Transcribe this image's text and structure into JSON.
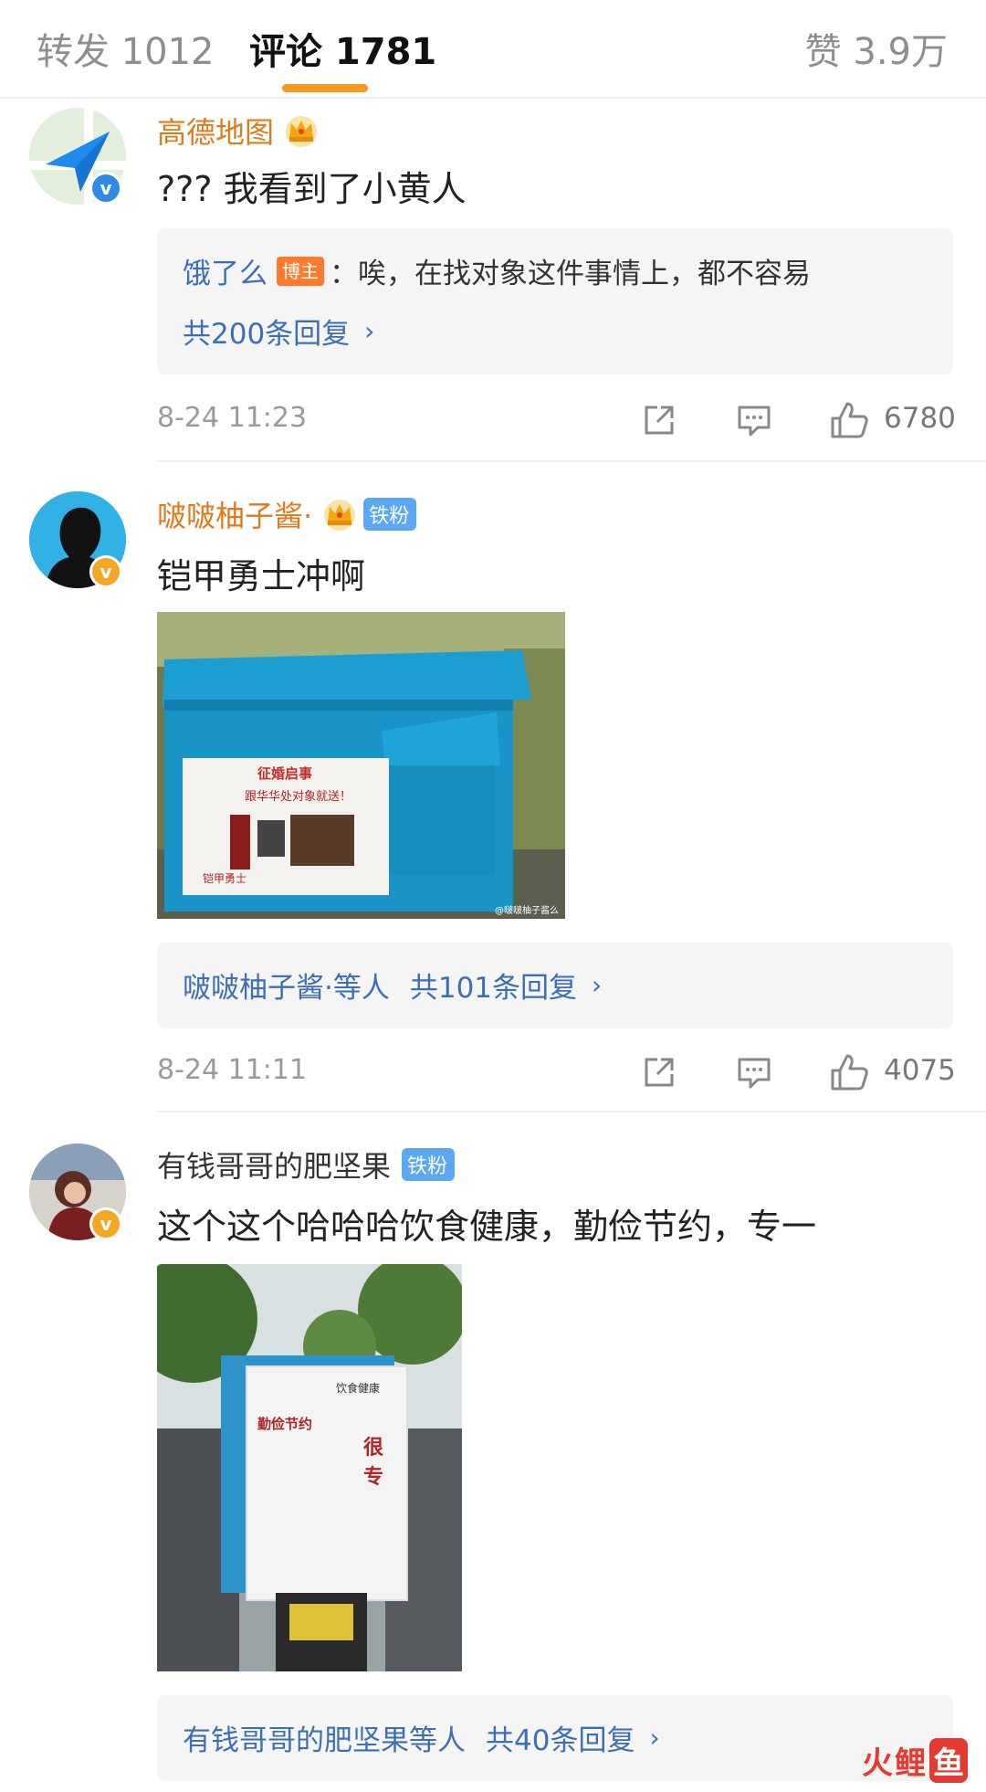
{
  "tabs": {
    "repost_label": "转发 1012",
    "comments_label": "评论 1781",
    "likes_label": "赞 3.9万",
    "accent_color": "#f79a19"
  },
  "comments": [
    {
      "username": "高德地图",
      "verified": "blue",
      "text": "??? 我看到了小黄人",
      "reply": {
        "user": "饿了么",
        "badge": "博主",
        "text": "：唉，在找对象这件事情上，都不容易",
        "count_label": "共200条回复"
      },
      "time": "8-24 11:23",
      "likes": "6780"
    },
    {
      "username": "啵啵柚子酱·",
      "verified": "gold",
      "fan_badge": "铁粉",
      "text": "铠甲勇士冲啊",
      "photo": {
        "sign_title": "征婚启事",
        "sign_lines": [
          "跟华华处对象就送！",
          "铠甲勇士"
        ],
        "watermark": "@啵啵柚子酱么"
      },
      "reply_summary": {
        "users": "啵啵柚子酱·等人",
        "count_label": "共101条回复"
      },
      "time": "8-24 11:11",
      "likes": "4075"
    },
    {
      "username": "有钱哥哥的肥坚果",
      "verified": "gold",
      "fan_badge": "铁粉",
      "text": "这个这个哈哈哈饮食健康，勤俭节约，专一",
      "photo": {
        "sign_lines": [
          "勤俭节约",
          "很",
          "专",
          "饮食健康"
        ]
      },
      "reply_summary": {
        "users": "有钱哥哥的肥坚果等人",
        "count_label": "共40条回复"
      }
    }
  ],
  "watermark": {
    "part1": "火",
    "part2": "鲤",
    "part3": "鱼"
  },
  "icons": {
    "share": "share-icon",
    "reply": "comment-icon",
    "like": "thumbs-up-icon",
    "chevron": "chevron-right-icon"
  },
  "glyphs": {
    "chevron": "›",
    "verified": "v"
  }
}
